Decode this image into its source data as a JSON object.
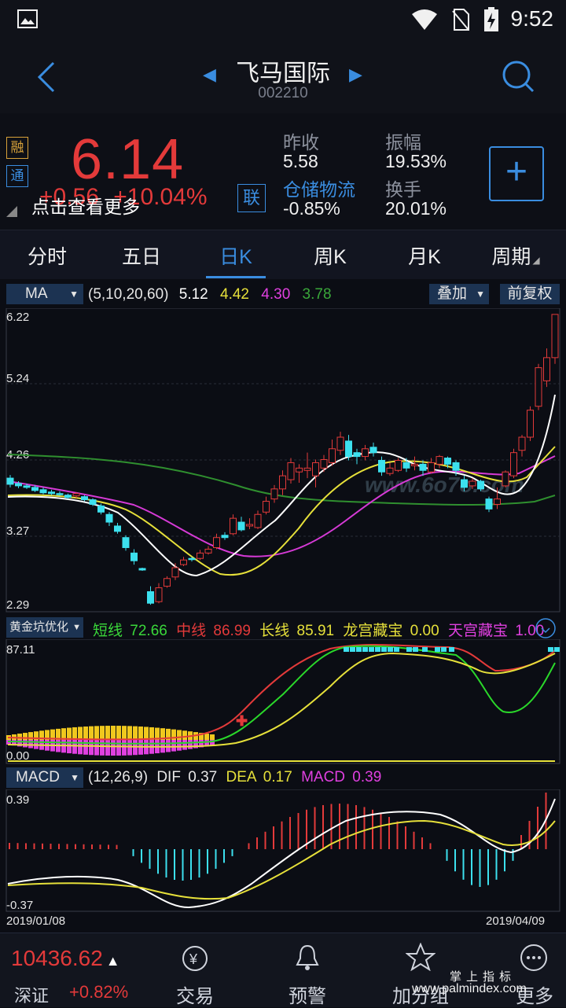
{
  "status_bar": {
    "time": "9:52"
  },
  "header": {
    "title": "飞马国际",
    "code": "002210"
  },
  "quote": {
    "badge_rong": "融",
    "badge_tong": "通",
    "price": "6.14",
    "change": "+0.56",
    "change_pct": "+10.04%",
    "hint": "点击查看更多",
    "lian": "联",
    "prev_close_label": "昨收",
    "prev_close": "5.58",
    "amplitude_label": "振幅",
    "amplitude": "19.53%",
    "sector_label": "仓储物流",
    "sector_change": "-0.85%",
    "turnover_label": "换手",
    "turnover": "20.01%",
    "add_label": "+"
  },
  "tabs": [
    "分时",
    "五日",
    "日K",
    "周K",
    "月K",
    "周期"
  ],
  "ma_bar": {
    "selector": "MA",
    "params": "(5,10,20,60)",
    "v5": "5.12",
    "v10": "4.42",
    "v20": "4.30",
    "v60": "3.78",
    "overlay": "叠加",
    "adjust": "前复权"
  },
  "kline_axis": {
    "y1": "6.22",
    "y2": "5.24",
    "y3": "4.26",
    "y4": "3.27",
    "y5": "2.29"
  },
  "watermark": "www.6o7o.com",
  "gold_bar": {
    "selector": "黄金坑优化",
    "short_label": "短线",
    "short_val": "72.66",
    "mid_label": "中线",
    "mid_val": "86.99",
    "long_label": "长线",
    "long_val": "85.91",
    "lg_label": "龙宫藏宝",
    "lg_val": "0.00",
    "tg_label": "天宫藏宝",
    "tg_val": "1.00",
    "ymax": "87.11",
    "ymin": "0.00"
  },
  "macd_bar": {
    "selector": "MACD",
    "params": "(12,26,9)",
    "dif_label": "DIF",
    "dif": "0.37",
    "dea_label": "DEA",
    "dea": "0.17",
    "macd_label": "MACD",
    "macd": "0.39",
    "ymax": "0.39",
    "ymin": "-0.37",
    "date_start": "2019/01/08",
    "date_end": "2019/04/09"
  },
  "footer": {
    "index_value": "10436.62",
    "index_name": "深证",
    "index_change": "+0.82%",
    "trade": "交易",
    "alert": "预警",
    "watchlist": "加分组",
    "more": "更多",
    "site_a": "掌上指标",
    "site_b": "www.palmindex.com"
  },
  "colors": {
    "up": "#e33a3a",
    "down": "#3ce0ee",
    "accent": "#3a8de0",
    "ma5": "#ffffff",
    "ma10": "#e6e03a",
    "ma20": "#e040e0",
    "ma60": "#3aa83a"
  }
}
